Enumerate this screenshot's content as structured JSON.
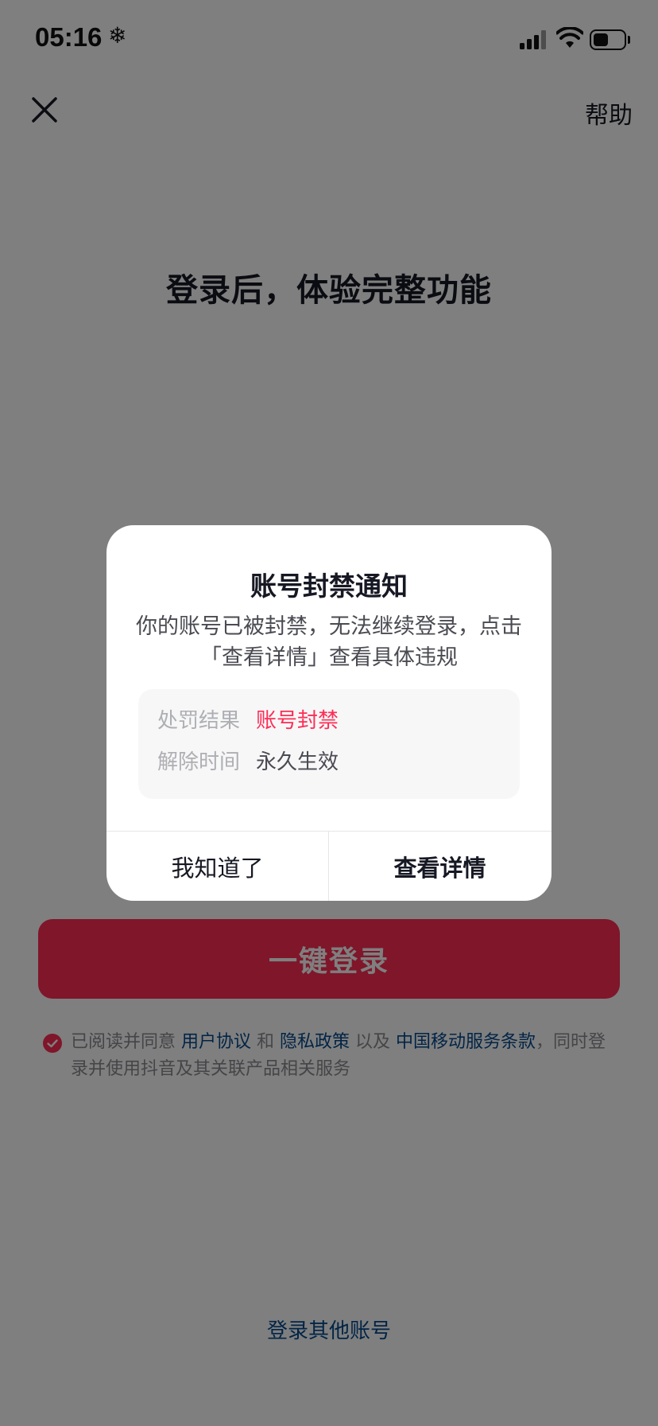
{
  "status_bar": {
    "time": "05:16",
    "extra_icon": "❄"
  },
  "nav": {
    "close_icon": "close-icon",
    "help_label": "帮助"
  },
  "login": {
    "title": "登录后，体验完整功能",
    "button_label": "一键登录",
    "agreement": {
      "prefix": "已阅读并同意 ",
      "user_agreement": "用户协议",
      "and": " 和 ",
      "privacy_policy": "隐私政策",
      "and_also": " 以及 ",
      "carrier_terms": "中国移动服务条款",
      "suffix": "，同时登录并使用抖音及其关联产品相关服务"
    },
    "other_account": "登录其他账号"
  },
  "modal": {
    "title": "账号封禁通知",
    "message": "你的账号已被封禁，无法继续登录，点击「查看详情」查看具体违规",
    "penalty_label": "处罚结果",
    "penalty_value": "账号封禁",
    "release_label": "解除时间",
    "release_value": "永久生效",
    "dismiss_label": "我知道了",
    "details_label": "查看详情"
  },
  "colors": {
    "accent": "#fe2c55",
    "link": "#04498d",
    "overlay": "rgba(0,0,0,0.5)",
    "text_primary": "#161823"
  }
}
